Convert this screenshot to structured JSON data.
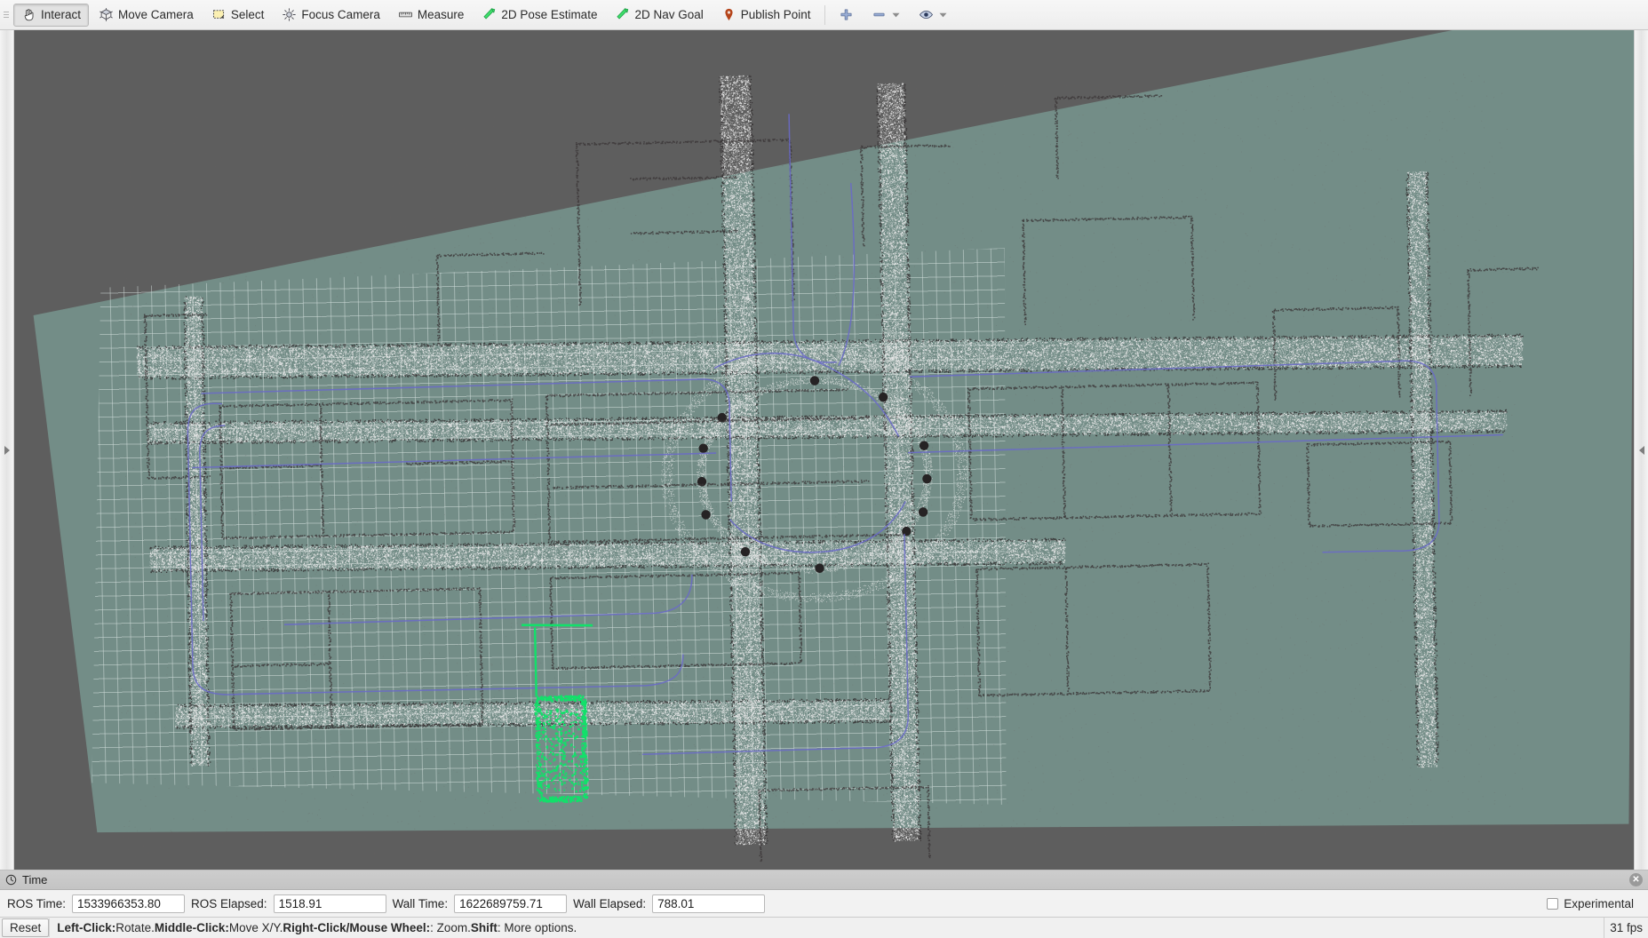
{
  "toolbar": {
    "buttons": [
      {
        "label": "Interact",
        "icon": "hand-cursor-icon",
        "active": true
      },
      {
        "label": "Move Camera",
        "icon": "move-camera-icon",
        "active": false
      },
      {
        "label": "Select",
        "icon": "select-rect-icon",
        "active": false
      },
      {
        "label": "Focus Camera",
        "icon": "focus-camera-icon",
        "active": false
      },
      {
        "label": "Measure",
        "icon": "ruler-icon",
        "active": false
      },
      {
        "label": "2D Pose Estimate",
        "icon": "green-arrow-icon",
        "active": false
      },
      {
        "label": "2D Nav Goal",
        "icon": "green-arrow-icon",
        "active": false
      },
      {
        "label": "Publish Point",
        "icon": "map-pin-icon",
        "active": false
      }
    ],
    "tools": [
      {
        "icon": "plus-icon",
        "dropdown": false
      },
      {
        "icon": "minus-icon",
        "dropdown": true
      },
      {
        "icon": "eye-icon",
        "dropdown": true
      }
    ]
  },
  "viewport": {
    "background_color": "#5e5e5e",
    "ground_color": "#738d87",
    "grid_color": "#dee8e6",
    "pointcloud_color": "#e8e8e8",
    "trajectory_color": "#6a6ac8",
    "laserscan_color": "#12e06a",
    "left_handle_icon": "expand-right-arrow-icon",
    "right_handle_icon": "expand-left-arrow-icon"
  },
  "time_panel": {
    "title": "Time",
    "title_icon": "clock-icon",
    "close_icon": "close-icon",
    "fields": [
      {
        "label": "ROS Time:",
        "value": "1533966353.80"
      },
      {
        "label": "ROS Elapsed:",
        "value": "1518.91"
      },
      {
        "label": "Wall Time:",
        "value": "1622689759.71"
      },
      {
        "label": "Wall Elapsed:",
        "value": "788.01"
      }
    ],
    "experimental_label": "Experimental",
    "experimental_checked": false
  },
  "bottom_bar": {
    "reset_label": "Reset",
    "hint_segments": [
      {
        "text": "Left-Click:",
        "bold": true
      },
      {
        "text": " Rotate. ",
        "bold": false
      },
      {
        "text": "Middle-Click:",
        "bold": true
      },
      {
        "text": " Move X/Y. ",
        "bold": false
      },
      {
        "text": "Right-Click/Mouse Wheel:",
        "bold": true
      },
      {
        "text": ": Zoom. ",
        "bold": false
      },
      {
        "text": "Shift",
        "bold": true
      },
      {
        "text": ": More options.",
        "bold": false
      }
    ],
    "fps": "31 fps"
  }
}
